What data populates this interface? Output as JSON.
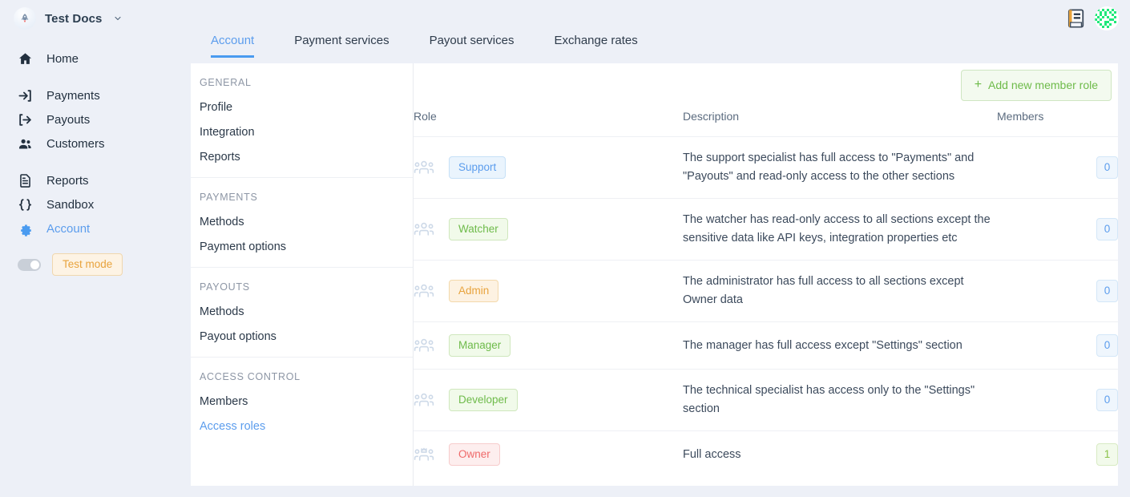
{
  "brand": {
    "name": "Test Docs",
    "logo_icon": "rocket-icon",
    "caret_icon": "chevron-down-icon"
  },
  "topbar": {
    "docs_icon": "book-icon",
    "avatar_icon": "user-avatar-identicon"
  },
  "sidebar": {
    "groups": [
      {
        "items": [
          {
            "label": "Home",
            "icon": "home-icon",
            "name": "home",
            "active": false
          }
        ]
      },
      {
        "items": [
          {
            "label": "Payments",
            "icon": "arrow-into-bracket-icon",
            "name": "payments",
            "active": false
          },
          {
            "label": "Payouts",
            "icon": "arrow-out-of-bracket-icon",
            "name": "payouts",
            "active": false
          },
          {
            "label": "Customers",
            "icon": "people-icon",
            "name": "customers",
            "active": false
          }
        ]
      },
      {
        "items": [
          {
            "label": "Reports",
            "icon": "document-icon",
            "name": "reports",
            "active": false
          },
          {
            "label": "Sandbox",
            "icon": "code-braces-icon",
            "name": "sandbox",
            "active": false
          },
          {
            "label": "Account",
            "icon": "gear-icon",
            "name": "account",
            "active": true
          }
        ]
      }
    ],
    "test_mode": {
      "label": "Test mode",
      "enabled": false
    }
  },
  "tabs": [
    {
      "label": "Account",
      "active": true
    },
    {
      "label": "Payment services",
      "active": false
    },
    {
      "label": "Payout services",
      "active": false
    },
    {
      "label": "Exchange rates",
      "active": false
    }
  ],
  "submenu": [
    {
      "title": "GENERAL",
      "items": [
        {
          "label": "Profile",
          "active": false
        },
        {
          "label": "Integration",
          "active": false
        },
        {
          "label": "Reports",
          "active": false
        }
      ]
    },
    {
      "title": "PAYMENTS",
      "items": [
        {
          "label": "Methods",
          "active": false
        },
        {
          "label": "Payment options",
          "active": false
        }
      ]
    },
    {
      "title": "PAYOUTS",
      "items": [
        {
          "label": "Methods",
          "active": false
        },
        {
          "label": "Payout options",
          "active": false
        }
      ]
    },
    {
      "title": "ACCESS CONTROL",
      "items": [
        {
          "label": "Members",
          "active": false
        },
        {
          "label": "Access roles",
          "active": true
        }
      ]
    }
  ],
  "main": {
    "add_button": {
      "label": "Add new member role",
      "icon": "plus-icon"
    },
    "table": {
      "headers": {
        "role": "Role",
        "description": "Description",
        "members": "Members"
      },
      "rows": [
        {
          "role": "Support",
          "description": "The support specialist has full access to \"Payments\" and \"Payouts\" and read-only access to the other sections",
          "members": "0",
          "badge_color": "#5c9ded",
          "badge_bg": "#eaf4fd",
          "badge_border": "#c6e0f7",
          "count_color": "#5c9ded",
          "count_bg": "#eff6fd",
          "count_border": "#d4e7f8",
          "icon": "users-group-icon"
        },
        {
          "role": "Watcher",
          "description": "The watcher has read-only access to all sections except the sensitive data like API keys, integration properties etc",
          "members": "0",
          "badge_color": "#6ebb4a",
          "badge_bg": "#f1faea",
          "badge_border": "#cfe7bd",
          "count_color": "#5c9ded",
          "count_bg": "#eff6fd",
          "count_border": "#d4e7f8",
          "icon": "users-group-icon"
        },
        {
          "role": "Admin",
          "description": "The administrator has full access to all sections except Owner data",
          "members": "0",
          "badge_color": "#e8a33d",
          "badge_bg": "#fdf2e2",
          "badge_border": "#f3d9ab",
          "count_color": "#5c9ded",
          "count_bg": "#eff6fd",
          "count_border": "#d4e7f8",
          "icon": "users-group-icon"
        },
        {
          "role": "Manager",
          "description": "The manager has full access except \"Settings\" section",
          "members": "0",
          "badge_color": "#6ebb4a",
          "badge_bg": "#f1faea",
          "badge_border": "#cfe7bd",
          "count_color": "#5c9ded",
          "count_bg": "#eff6fd",
          "count_border": "#d4e7f8",
          "icon": "users-group-icon"
        },
        {
          "role": "Developer",
          "description": "The technical specialist has access only to the \"Settings\" section",
          "members": "0",
          "badge_color": "#6ebb4a",
          "badge_bg": "#f1faea",
          "badge_border": "#cfe7bd",
          "count_color": "#5c9ded",
          "count_bg": "#eff6fd",
          "count_border": "#d4e7f8",
          "icon": "users-group-icon"
        },
        {
          "role": "Owner",
          "description": "Full access",
          "members": "1",
          "badge_color": "#ef6a6a",
          "badge_bg": "#fdeeee",
          "badge_border": "#f7cccc",
          "count_color": "#8bc34a",
          "count_bg": "#f2faeb",
          "count_border": "#d8ebc4",
          "icon": "users-group-crown-icon"
        }
      ]
    }
  },
  "colors": {
    "page_bg": "#edf0f7",
    "panel_bg": "#ffffff",
    "accent_blue": "#5c9ded",
    "accent_green": "#6ebb4a",
    "accent_orange": "#e8a33d",
    "accent_red": "#ef6a6a"
  }
}
